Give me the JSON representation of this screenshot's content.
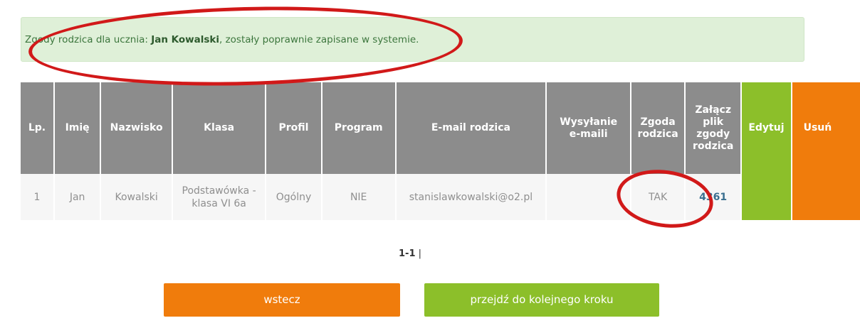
{
  "alert": {
    "prefix": "Zgody rodzica dla ucznia: ",
    "student_name": "Jan Kowalski",
    "suffix": ", zostały poprawnie zapisane w systemie."
  },
  "table": {
    "headers": {
      "lp": "Lp.",
      "imie": "Imię",
      "nazwisko": "Nazwisko",
      "klasa": "Klasa",
      "profil": "Profil",
      "program": "Program",
      "email": "E-mail rodzica",
      "wysylanie": "Wysyłanie e-maili",
      "zgoda": "Zgoda rodzica",
      "zalacz": "Załącz plik zgody rodzica",
      "edytuj": "Edytuj",
      "usun": "Usuń"
    },
    "rows": [
      {
        "lp": "1",
        "imie": "Jan",
        "nazwisko": "Kowalski",
        "klasa": "Podstawówka - klasa VI 6a",
        "profil": "Ogólny",
        "program": "NIE",
        "email": "stanislawkowalski@o2.pl",
        "wysylanie": "",
        "zgoda": "TAK",
        "plik": "4361",
        "edytuj": "",
        "usun": ""
      }
    ]
  },
  "pager": {
    "range": "1-1",
    "separator": " |"
  },
  "buttons": {
    "back": "wstecz",
    "next": "przejdź do kolejnego kroku"
  },
  "colors": {
    "accent_green": "#8cbf2a",
    "accent_orange": "#f07c0c",
    "header_gray": "#8c8c8c",
    "annotation_red": "#d11919"
  }
}
